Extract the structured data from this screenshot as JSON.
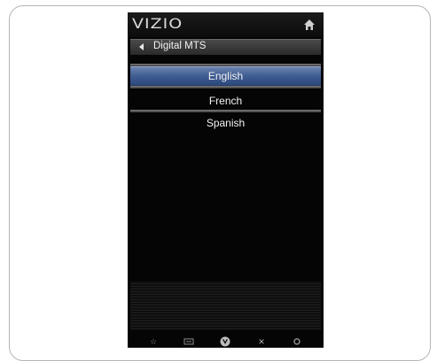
{
  "header": {
    "logo": "VIZIO",
    "home_icon": "home-icon"
  },
  "menu": {
    "title": "Digital MTS",
    "back_icon": "back-arrow-icon",
    "options": [
      {
        "label": "English",
        "selected": true
      },
      {
        "label": "French",
        "selected": false
      },
      {
        "label": "Spanish",
        "selected": false
      }
    ]
  },
  "bottom_bar": {
    "icons": [
      "star-icon",
      "keyboard-icon",
      "v-logo-icon",
      "close-icon",
      "settings-icon"
    ],
    "glyphs": {
      "star": "☆",
      "close": "×"
    }
  },
  "colors": {
    "selected_option": "#3c5a8f",
    "panel_background": "#050505"
  }
}
